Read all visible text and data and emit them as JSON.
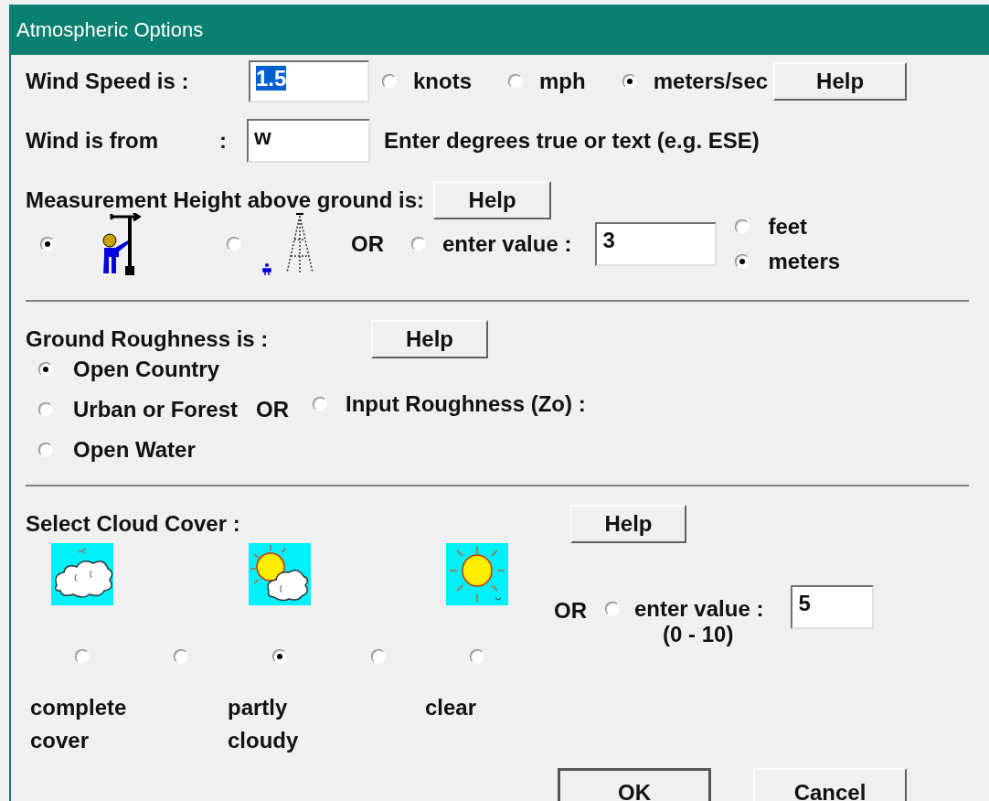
{
  "window": {
    "title": "Atmospheric Options"
  },
  "wind_speed": {
    "label": "Wind Speed is :",
    "value": "1.5",
    "text_selected": true,
    "help": "Help",
    "units": [
      {
        "label": "knots",
        "selected": false
      },
      {
        "label": "mph",
        "selected": false
      },
      {
        "label": "meters/sec",
        "selected": true
      }
    ]
  },
  "wind_direction": {
    "label": "Wind is from",
    "colon": ":",
    "value": "w",
    "hint": "Enter degrees true or text (e.g. ESE)"
  },
  "measurement_height": {
    "label": "Measurement Height above ground is:",
    "help": "Help",
    "presets": [
      {
        "kind": "person",
        "selected": true
      },
      {
        "kind": "tower",
        "selected": false
      }
    ],
    "or": "OR",
    "custom": {
      "label": "enter value :",
      "selected": false
    },
    "value": "3",
    "units": [
      {
        "label": "feet",
        "selected": false
      },
      {
        "label": "meters",
        "selected": true
      }
    ]
  },
  "ground_roughness": {
    "label": "Ground Roughness is :",
    "help": "Help",
    "options": [
      {
        "label": "Open Country",
        "selected": true
      },
      {
        "label": "Urban or Forest",
        "selected": false
      },
      {
        "label": "Open Water",
        "selected": false
      }
    ],
    "or": "OR",
    "custom": {
      "label": "Input Roughness (Zo) :",
      "selected": false
    }
  },
  "cloud_cover": {
    "label": "Select Cloud Cover :",
    "help": "Help",
    "levels": [
      {
        "kind": "overcast",
        "label": "complete cover",
        "selected": false
      },
      {
        "selected": false
      },
      {
        "kind": "partly",
        "label": "partly cloudy",
        "selected": true
      },
      {
        "selected": false
      },
      {
        "kind": "clear",
        "label": "clear",
        "selected": false
      }
    ],
    "or": "OR",
    "custom": {
      "label": "enter value :",
      "range": "(0 - 10)",
      "selected": false
    },
    "value": "5"
  },
  "buttons": [
    {
      "label": "OK",
      "default": true
    },
    {
      "label": "Cancel",
      "default": false
    }
  ]
}
